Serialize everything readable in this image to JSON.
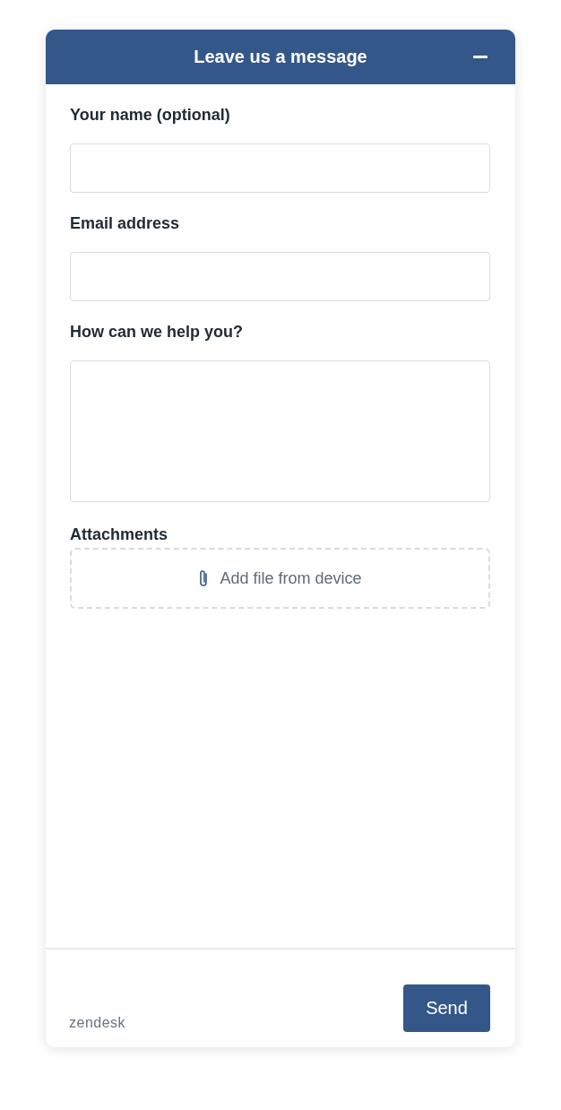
{
  "header": {
    "title": "Leave us a message"
  },
  "fields": [
    {
      "kind": "input",
      "label": "Your name (optional)"
    },
    {
      "kind": "input",
      "label": "Email address"
    },
    {
      "kind": "textarea",
      "label": "How can we help you?"
    }
  ],
  "attachments": {
    "label": "Attachments",
    "action": "Add file from device"
  },
  "footer": {
    "brand": "zendesk",
    "send": "Send"
  }
}
